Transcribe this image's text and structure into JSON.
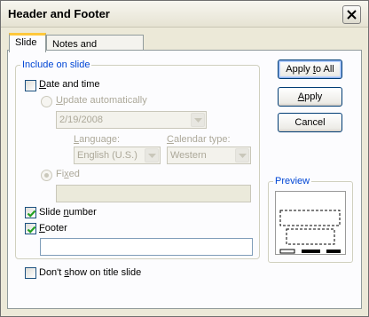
{
  "window": {
    "title": "Header and Footer"
  },
  "tabs": [
    {
      "label": "Slide",
      "active": true
    },
    {
      "label": "Notes and Handouts",
      "active": false
    }
  ],
  "include_group": {
    "label": "Include on slide"
  },
  "date_time": {
    "checkbox_label_prefix": "",
    "checkbox_label_u": "D",
    "checkbox_label_rest": "ate and time",
    "checked": false,
    "update_auto_prefix": "",
    "update_auto_u": "U",
    "update_auto_rest": "pdate automatically",
    "date_value": "2/19/2008",
    "language_label_prefix": "",
    "language_label_u": "L",
    "language_label_rest": "anguage:",
    "language_value": "English (U.S.)",
    "calendar_label_prefix": "",
    "calendar_label_u": "C",
    "calendar_label_rest": "alendar type:",
    "calendar_value": "Western",
    "fixed_prefix": "Fi",
    "fixed_u": "x",
    "fixed_rest": "ed",
    "fixed_value": ""
  },
  "slide_number": {
    "prefix": "Slide ",
    "u": "n",
    "rest": "umber",
    "checked": true
  },
  "footer": {
    "prefix": "",
    "u": "F",
    "rest": "ooter",
    "checked": true,
    "value": ""
  },
  "dont_show_title": {
    "prefix": "Don't ",
    "u": "s",
    "rest": "how on title slide",
    "checked": false
  },
  "buttons": {
    "apply_all_prefix": "Apply ",
    "apply_all_u": "t",
    "apply_all_rest": "o All",
    "apply_prefix": "",
    "apply_u": "A",
    "apply_rest": "pply",
    "cancel": "Cancel"
  },
  "preview": {
    "label": "Preview"
  }
}
